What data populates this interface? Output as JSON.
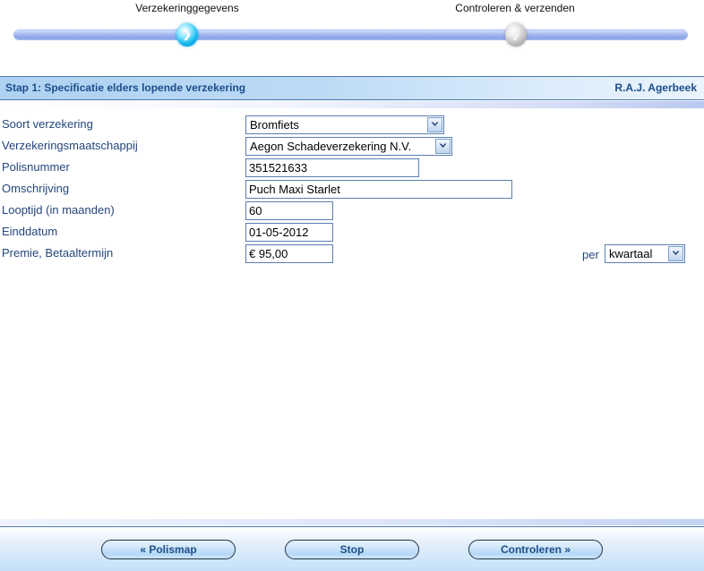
{
  "wizard": {
    "steps": [
      {
        "label": "Verzekeringgegevens",
        "state": "active",
        "icon": "chevron-right-icon",
        "glyph": "❯"
      },
      {
        "label": "Controleren & verzenden",
        "state": "inactive",
        "icon": "chevron-right-icon",
        "glyph": "❯"
      }
    ],
    "accent_active": "#15b9ef",
    "accent_inactive": "#bdbdbd",
    "track_color": "#9fb4ee"
  },
  "header": {
    "title": "Stap 1: Specificatie elders lopende verzekering",
    "user": "R.A.J. Agerbeek",
    "accent": "#1c4e8a"
  },
  "form": {
    "rows": [
      {
        "label": "Soort verzekering",
        "control": "select",
        "name": "soort-verzekering",
        "value": "Bromfiets"
      },
      {
        "label": "Verzekeringsmaatschappij",
        "control": "select",
        "name": "verzekeringsmaatschappij",
        "value": "Aegon Schadeverzekering N.V."
      },
      {
        "label": "Polisnummer",
        "control": "text",
        "name": "polisnummer",
        "value": "351521633",
        "placeholder": ""
      },
      {
        "label": "Omschrijving",
        "control": "text",
        "name": "omschrijving",
        "value": "Puch Maxi Starlet",
        "placeholder": ""
      },
      {
        "label": "Looptijd (in maanden)",
        "control": "text",
        "name": "looptijd",
        "value": "60",
        "placeholder": ""
      },
      {
        "label": "Einddatum",
        "control": "text",
        "name": "einddatum",
        "value": "01-05-2012",
        "placeholder": ""
      },
      {
        "label": "Premie, Betaaltermijn",
        "control": "text-and-select",
        "name": "premie-betaaltermijn",
        "value": "€ 95,00",
        "placeholder": "",
        "separator": "per",
        "select_value": "kwartaal"
      }
    ]
  },
  "footer": {
    "buttons": [
      {
        "label": "« Polismap",
        "name": "polismap-button"
      },
      {
        "label": "Stop",
        "name": "stop-button"
      },
      {
        "label": "Controleren »",
        "name": "controleren-button"
      }
    ]
  }
}
